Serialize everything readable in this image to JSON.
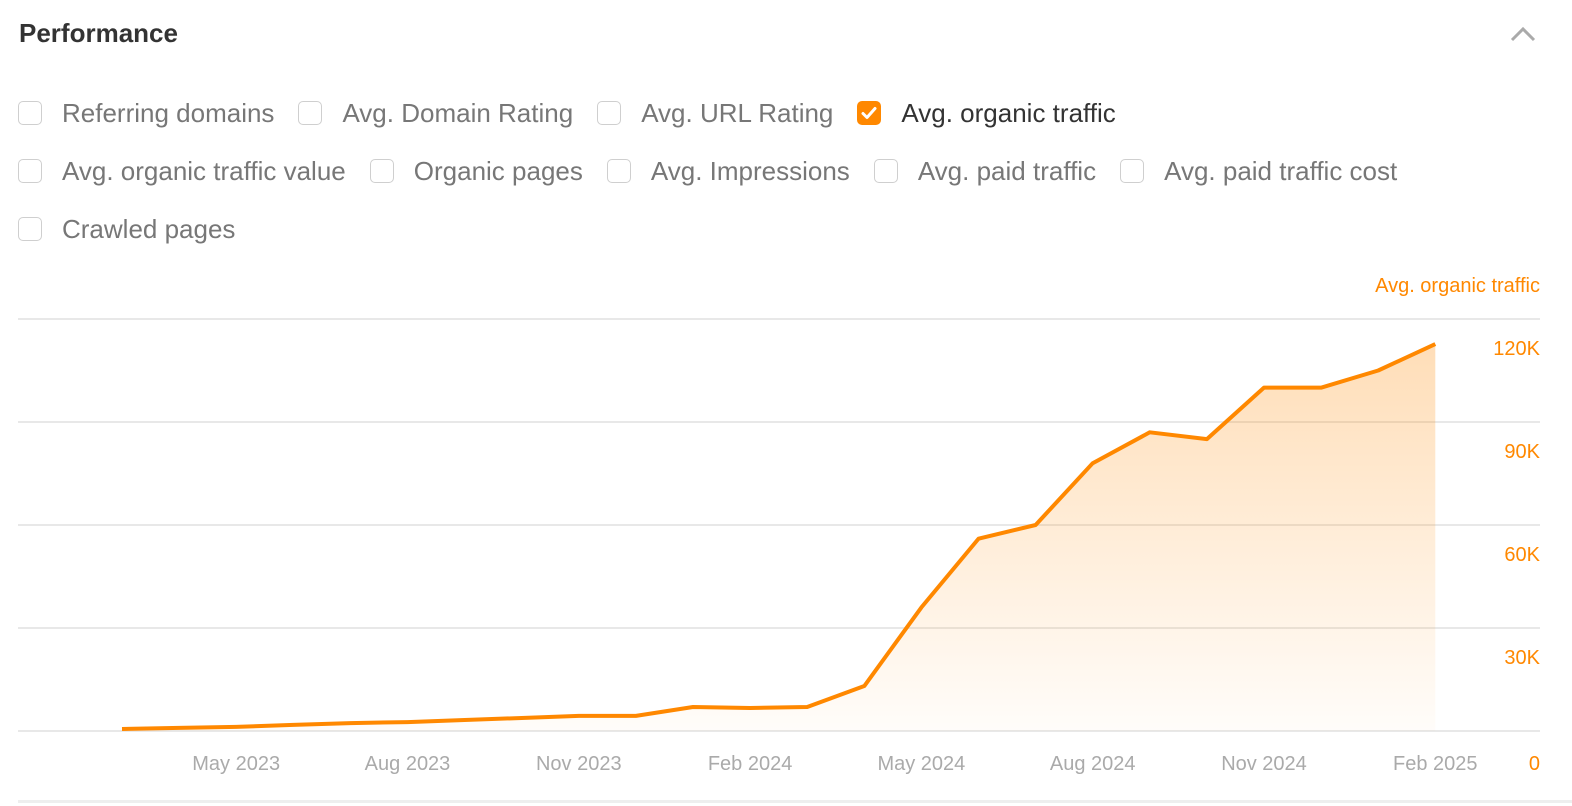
{
  "header": {
    "title": "Performance",
    "collapse_icon": "chevron-up-icon"
  },
  "filters": [
    [
      {
        "label": "Referring domains",
        "checked": false
      },
      {
        "label": "Avg. Domain Rating",
        "checked": false
      },
      {
        "label": "Avg. URL Rating",
        "checked": false
      },
      {
        "label": "Avg. organic traffic",
        "checked": true
      }
    ],
    [
      {
        "label": "Avg. organic traffic value",
        "checked": false
      },
      {
        "label": "Organic pages",
        "checked": false
      },
      {
        "label": "Avg. Impressions",
        "checked": false
      },
      {
        "label": "Avg. paid traffic",
        "checked": false
      },
      {
        "label": "Avg. paid traffic cost",
        "checked": false
      }
    ],
    [
      {
        "label": "Crawled pages",
        "checked": false
      }
    ]
  ],
  "colors": {
    "accent": "#ff8800",
    "grid": "#e8e8e8",
    "tick": "#aaaaaa"
  },
  "chart_data": {
    "type": "area",
    "title": "",
    "series": [
      {
        "name": "Avg. organic traffic",
        "x": [
          "Mar 2023",
          "Apr 2023",
          "May 2023",
          "Jun 2023",
          "Jul 2023",
          "Aug 2023",
          "Sep 2023",
          "Oct 2023",
          "Nov 2023",
          "Dec 2023",
          "Jan 2024",
          "Feb 2024",
          "Mar 2024",
          "Apr 2024",
          "May 2024",
          "Jun 2024",
          "Jul 2024",
          "Aug 2024",
          "Sep 2024",
          "Oct 2024",
          "Nov 2024",
          "Dec 2024",
          "Jan 2025",
          "Feb 2025"
        ],
        "values": [
          600,
          900,
          1200,
          1800,
          2300,
          2600,
          3200,
          3800,
          4400,
          4400,
          7000,
          6700,
          7000,
          13100,
          36000,
          56000,
          60000,
          78000,
          87000,
          85000,
          100000,
          100000,
          105000,
          112700
        ]
      }
    ],
    "xlabel": "",
    "ylabel": "Avg. organic traffic",
    "x_tick_labels": [
      "May 2023",
      "Aug 2023",
      "Nov 2023",
      "Feb 2024",
      "May 2024",
      "Aug 2024",
      "Nov 2024",
      "Feb 2025"
    ],
    "y_ticks": [
      0,
      30000,
      60000,
      90000,
      120000
    ],
    "y_tick_labels": [
      "0",
      "30K",
      "60K",
      "90K",
      "120K"
    ],
    "ylim": [
      0,
      120000
    ],
    "y_axis_side": "right",
    "grid": true,
    "legend": "none"
  }
}
